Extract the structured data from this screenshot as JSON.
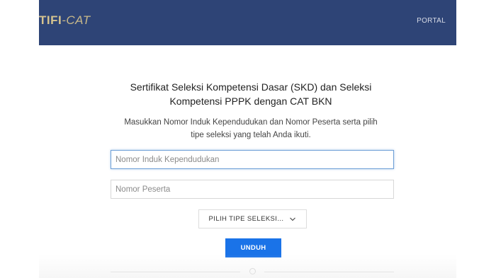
{
  "header": {
    "logo_strong": "TIFI",
    "logo_thin": "-CAT",
    "portal_label": "PORTAL"
  },
  "main": {
    "title": "Sertifikat Seleksi Kompetensi Dasar (SKD) dan Seleksi Kompetensi PPPK dengan CAT BKN",
    "subtitle": "Masukkan Nomor Induk Kependudukan dan Nomor Peserta serta pilih tipe seleksi yang telah Anda ikuti.",
    "nik_placeholder": "Nomor Induk Kependudukan",
    "nik_value": "",
    "peserta_placeholder": "Nomor Peserta",
    "peserta_value": "",
    "select_label": "PILIH TIPE SELEKSI...",
    "download_label": "UNDUH"
  },
  "colors": {
    "header_bg": "#2e4476",
    "button_bg": "#1a73e8"
  },
  "icons": {
    "select_chevron": "chevron-down-icon"
  }
}
